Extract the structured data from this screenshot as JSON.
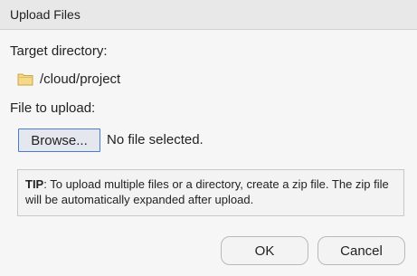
{
  "window": {
    "title": "Upload Files"
  },
  "target": {
    "label": "Target directory:",
    "path": "/cloud/project",
    "icon": "folder-icon"
  },
  "file": {
    "label": "File to upload:",
    "browse_label": "Browse...",
    "status": "No file selected."
  },
  "tip": {
    "prefix": "TIP",
    "text": ": To upload multiple files or a directory, create a zip file. The zip file will be automatically expanded after upload."
  },
  "buttons": {
    "ok": "OK",
    "cancel": "Cancel"
  },
  "colors": {
    "accent_border": "#4a7bd0",
    "folder_fill": "#f5d98a"
  }
}
